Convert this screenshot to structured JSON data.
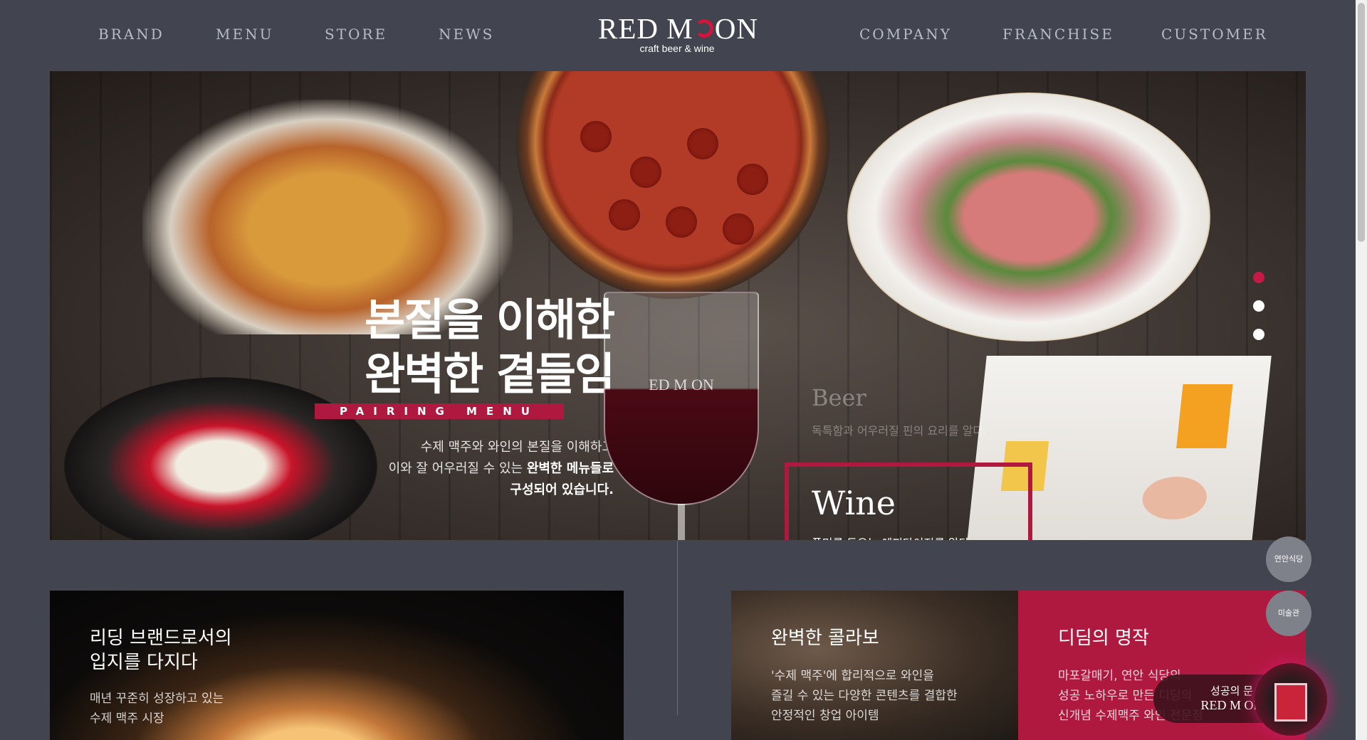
{
  "nav": {
    "left": [
      "BRAND",
      "MENU",
      "STORE",
      "NEWS"
    ],
    "right": [
      "COMPANY",
      "FRANCHISE",
      "CUSTOMER"
    ]
  },
  "logo": {
    "title_a": "RED M",
    "title_b": "ON",
    "subtitle": "craft beer & wine"
  },
  "hero": {
    "headline_line1": "본질을 이해한",
    "headline_line2": "완벽한 곁들임",
    "tag": "PAIRING MENU",
    "desc_line1": "수제 맥주와 와인의 본질을 이해하고",
    "desc_line2_plain": "이와 잘 어우러질 수 있는 ",
    "desc_line2_bold": "완벽한 메뉴들로",
    "desc_line3": "구성되어 있습니다.",
    "glass_logo": "ED M  ON",
    "beer_label": "Beer",
    "beer_desc": "독특함과 어우러질 핀의 요리를 알다.",
    "wine_label": "Wine",
    "wine_desc": "풍미를 돋우는 에피타이저를 알다."
  },
  "slider": {
    "count": 3,
    "active_index": 0
  },
  "cards": {
    "left": {
      "title_line1": "리딩 브랜드로서의",
      "title_line2": "입지를 다지다",
      "desc_line1": "매년 꾸준히 성장하고 있는",
      "desc_line2": "수제 맥주 시장"
    },
    "mid": {
      "title": "완벽한 콜라보",
      "desc_line1": "'수제 맥주'에 합리적으로 와인을",
      "desc_line2": "즐길 수 있는 다양한 콘텐츠를 결합한",
      "desc_line3": "안정적인 창업 아이템"
    },
    "right": {
      "title": "디딤의 명작",
      "desc_line1": "마포갈매기, 연안 식당의",
      "desc_line2": "성공 노하우로 만든 디딤의",
      "desc_line3": "신개념 수제맥주 와인 전문점"
    }
  },
  "widgets": {
    "circle1": "연안식당",
    "circle2": "미술관",
    "success_line1": "성공의 문",
    "success_line2": "RED M  ON"
  },
  "colors": {
    "accent": "#b0193f",
    "background": "#424550",
    "nav_text": "#b8bcc8"
  }
}
